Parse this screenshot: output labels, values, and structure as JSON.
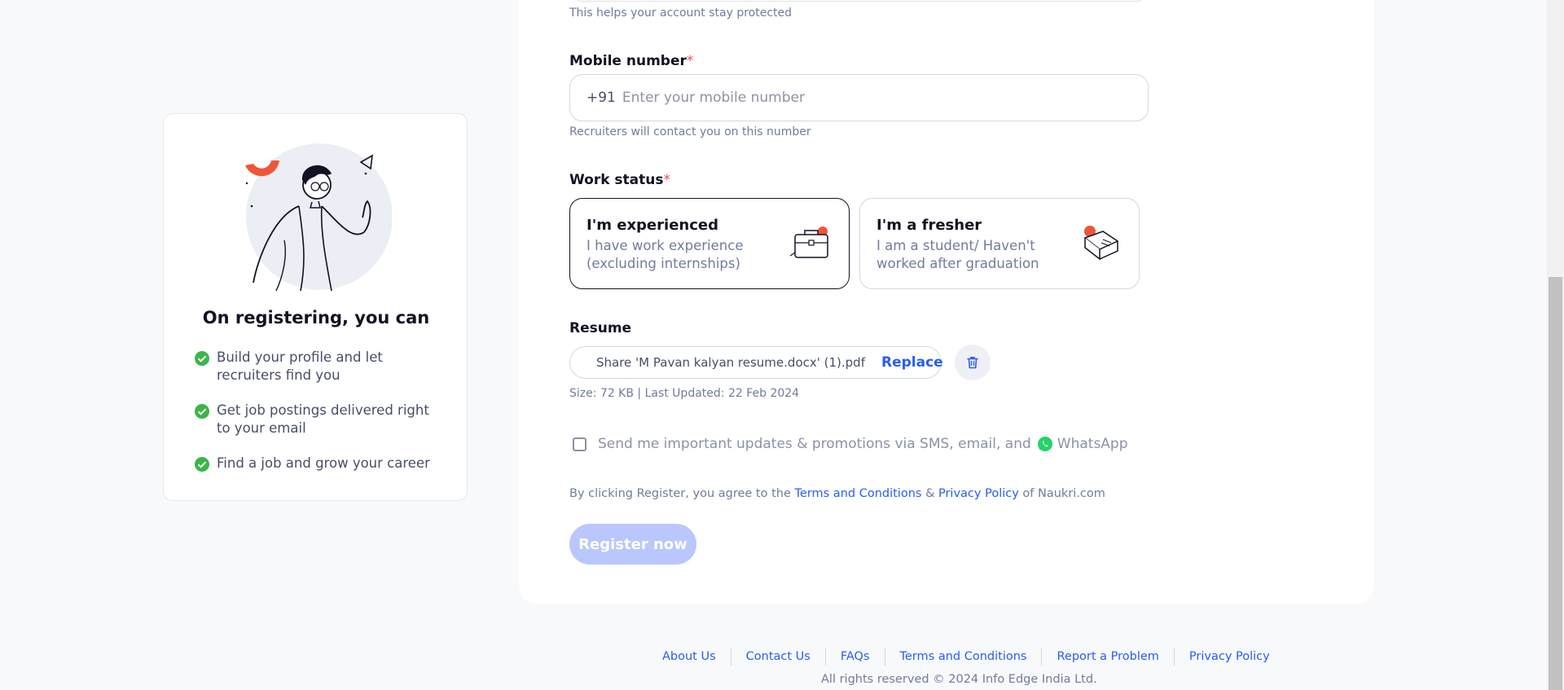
{
  "account_helper": "This helps your account stay protected",
  "mobile": {
    "label": "Mobile number",
    "required_mark": "*",
    "prefix": "+91",
    "placeholder": "Enter your mobile number",
    "helper": "Recruiters will contact you on this number"
  },
  "work_status": {
    "label": "Work status",
    "required_mark": "*",
    "options": [
      {
        "title": "I'm experienced",
        "desc": "I have work experience (excluding internships)",
        "icon": "briefcase-icon",
        "selected": true
      },
      {
        "title": "I'm a fresher",
        "desc": "I am a student/ Haven't worked after graduation",
        "icon": "books-icon",
        "selected": false
      }
    ]
  },
  "resume": {
    "label": "Resume",
    "filename": "Share 'M Pavan kalyan resume.docx' (1).pdf",
    "replace_label": "Replace",
    "meta": "Size: 72 KB | Last Updated: 22 Feb 2024"
  },
  "consent": {
    "text": "Send me important updates & promotions via SMS, email, and",
    "whatsapp": "WhatsApp",
    "checked": false
  },
  "terms": {
    "prefix": "By clicking Register, you agree to the",
    "terms_link": "Terms and Conditions",
    "amp": "&",
    "privacy_link": "Privacy Policy",
    "suffix": "of Naukri.com"
  },
  "register_label": "Register now",
  "benefits": {
    "title": "On registering, you can",
    "items": [
      "Build your profile and let recruiters find you",
      "Get job postings delivered right to your email",
      "Find a job and grow your career"
    ]
  },
  "footer": {
    "links": [
      "About Us",
      "Contact Us",
      "FAQs",
      "Terms and Conditions",
      "Report a Problem",
      "Privacy Policy"
    ],
    "copyright": "All rights reserved © 2024 Info Edge India Ltd."
  },
  "colors": {
    "accent": "#275df5",
    "required": "#e84f4f",
    "register_disabled": "#b9c7fd",
    "check_green": "#3bb54a",
    "illustration_accent": "#f05537"
  }
}
